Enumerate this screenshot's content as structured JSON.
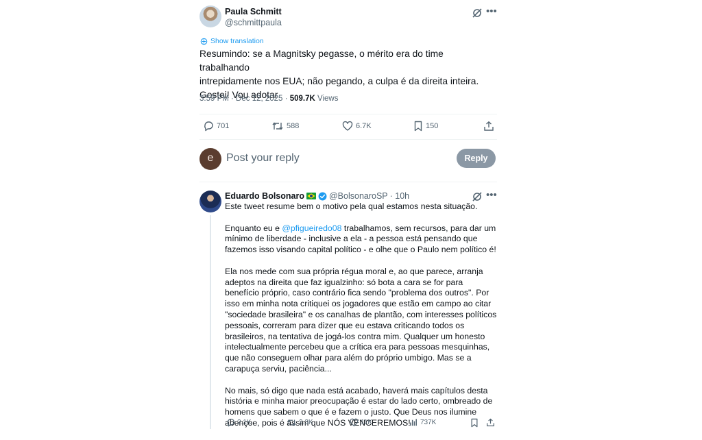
{
  "main_tweet": {
    "author_name": "Paula Schmitt",
    "author_handle": "@schmittpaula",
    "show_translation": "Show translation",
    "text": "Resumindo: se a Magnitsky pegasse, o mérito era do time trabalhando\nintrepidamente nos EUA; não pegando, a culpa é da direita inteira.\nGostei! Vou adotar",
    "timestamp": "3:59 PM · Dec 12, 2025 · ",
    "views_count": "509.7K",
    "views_label": " Views",
    "actions": {
      "replies": "701",
      "reposts": "588",
      "likes": "6.7K",
      "bookmarks": "150"
    }
  },
  "reply_composer": {
    "avatar_letter": "e",
    "placeholder": "Post your reply",
    "button_label": "Reply"
  },
  "reply_tweet": {
    "author_name": "Eduardo Bolsonaro",
    "author_handle": "@BolsonaroSP",
    "time": "· 10h",
    "p1": "Este tweet resume bem o motivo pela qual estamos nesta situação.",
    "p2_before": "Enquanto eu e ",
    "p2_mention": "@pfigueiredo08",
    "p2_after": " trabalhamos, sem recursos, para dar um mínimo de liberdade - inclusive a ela - a pessoa está pensando que fazemos isso visando capital político - e olhe que o Paulo nem político é!",
    "p3": "Ela nos mede com sua própria régua moral e, ao que parece, arranja adeptos na direita que faz igualzinho: só bota a cara se for para benefício próprio, caso contrário fica sendo \"problema dos outros\". Por isso em minha nota critiquei os jogadores que estão em campo ao citar \"sociedade brasileira\" e os canalhas de plantão, com interesses políticos pessoais, correram para dizer que eu estava criticando todos os brasileiros, na tentativa de jogá-los contra mim. Qualquer um honesto intelectualmente percebeu que a crítica era para pessoas mesquinhas, que não conseguem olhar para além do próprio umbigo. Mas se a carapuça serviu, paciência...",
    "p4": "No mais, só digo que nada está acabado, haverá mais capítulos desta história e minha maior preocupação é estar do lado certo, ombreado de homens que sabem o que é e fazem o justo. Que Deus nos ilumine abençoe, pois é assim que NÓS VENCEREMOS!",
    "actions": {
      "replies": "2.1K",
      "reposts": "2.3K",
      "likes": "11K",
      "views": "737K"
    }
  },
  "colors": {
    "link_blue": "#1d9bf0",
    "muted": "#536471",
    "reply_button_bg": "#8b98a5"
  },
  "icons": [
    "grok-icon",
    "more-icon",
    "translate-icon",
    "reply-icon",
    "repost-icon",
    "like-icon",
    "bookmark-icon",
    "share-icon",
    "views-icon",
    "brazil-flag-icon",
    "verified-icon"
  ]
}
